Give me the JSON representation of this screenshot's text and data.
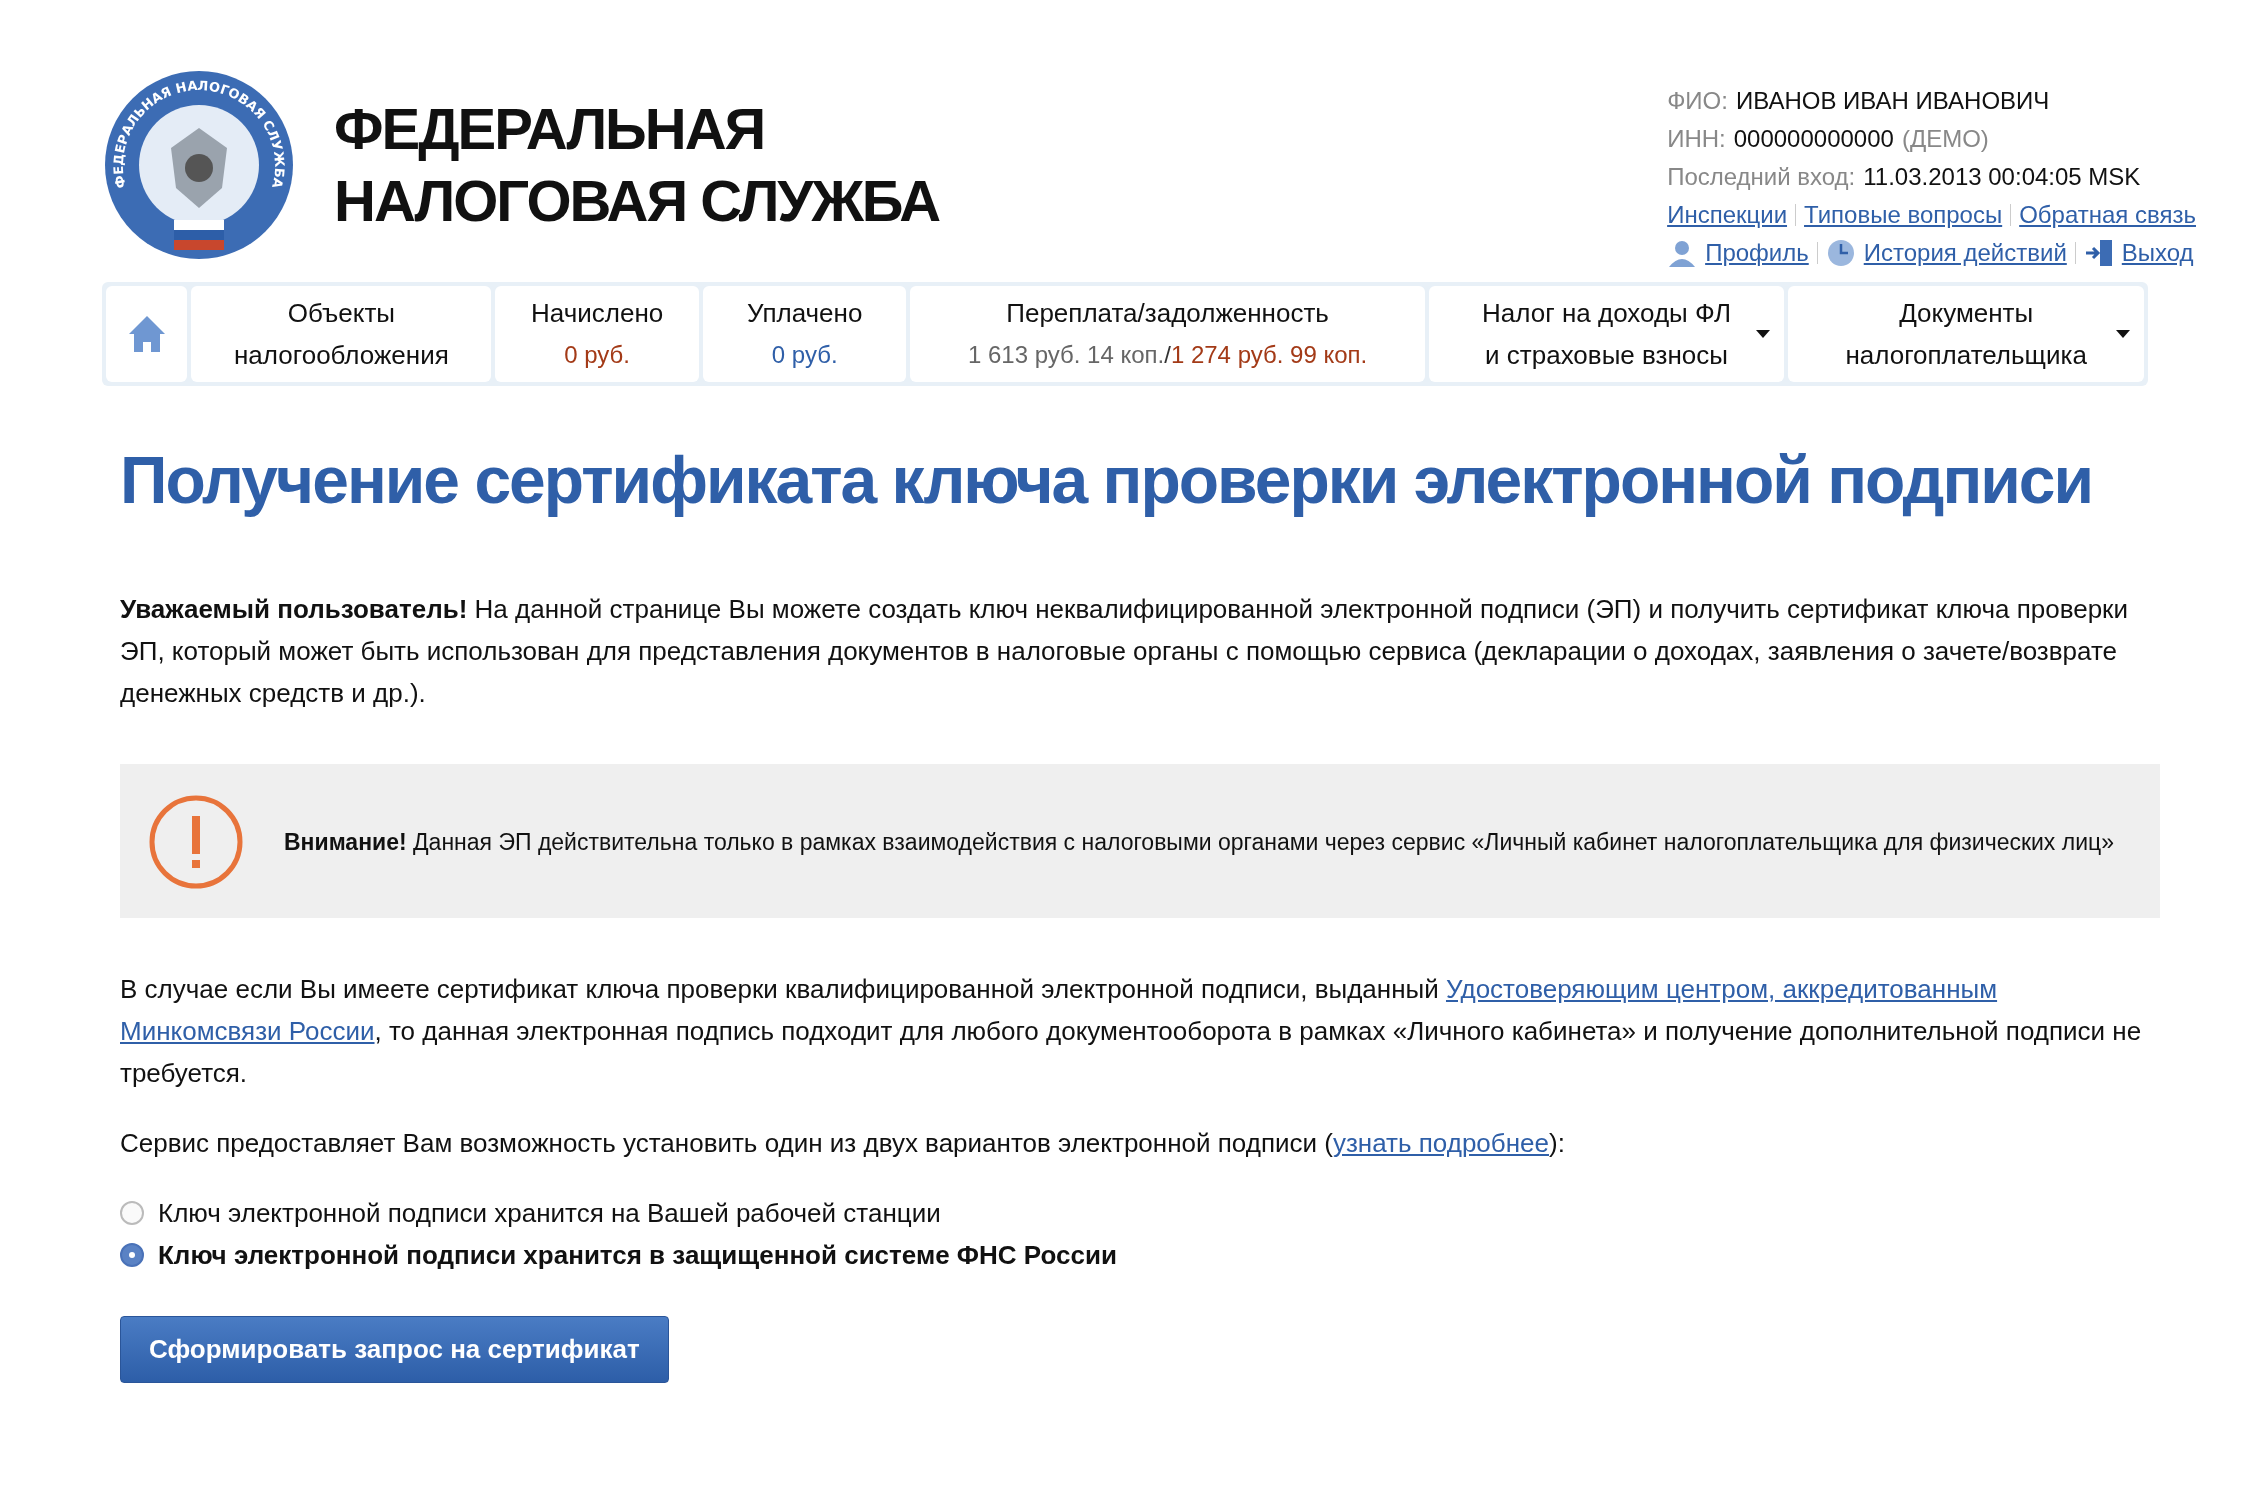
{
  "logo": {
    "ring_text": "ФЕДЕРАЛЬНАЯ НАЛОГОВАЯ СЛУЖБА",
    "title_lines": [
      "ФЕДЕРАЛЬНАЯ",
      "НАЛОГОВАЯ СЛУЖБА"
    ]
  },
  "user": {
    "fields": [
      {
        "label": "ФИО:",
        "value": "ИВАНОВ ИВАН ИВАНОВИЧ"
      },
      {
        "label": "ИНН:",
        "value": "000000000000",
        "note": "(ДЕМО)"
      },
      {
        "label": "Последний вход:",
        "value": "11.03.2013 00:04:05 MSK"
      }
    ],
    "links": [
      "Инспекции",
      "Типовые вопросы",
      "Обратная связь"
    ],
    "actions": [
      {
        "kind": "profile",
        "label": "Профиль"
      },
      {
        "kind": "history",
        "label": "История действий"
      },
      {
        "kind": "exit",
        "label": "Выход"
      }
    ]
  },
  "nav": [
    {
      "kind": "home"
    },
    {
      "kind": "text",
      "lines": [
        "Объекты",
        "налогообложения"
      ]
    },
    {
      "kind": "amount",
      "title": "Начислено",
      "amounts": [
        {
          "text": "0 руб.",
          "color": "#a33a17"
        }
      ]
    },
    {
      "kind": "amount",
      "title": "Уплачено",
      "amounts": [
        {
          "text": "0 руб.",
          "color": "#2f5fa8"
        }
      ]
    },
    {
      "kind": "amount",
      "title": "Переплата/задолженность",
      "amounts": [
        {
          "text": "1 613 руб. 14 коп.",
          "color": "#666666"
        },
        {
          "text": "/",
          "color": "#333333"
        },
        {
          "text": "1 274 руб. 99 коп.",
          "color": "#a33a17"
        }
      ]
    },
    {
      "kind": "dropdown",
      "lines": [
        "Налог на доходы ФЛ",
        "и страховые взносы"
      ]
    },
    {
      "kind": "dropdown",
      "lines": [
        "Документы",
        "налогоплательщика"
      ]
    }
  ],
  "heading": "Получение сертификата ключа проверки электронной подписи",
  "intro": "**Уважаемый пользователь!** На данной странице Вы можете создать ключ неквалифицированной электронной подписи (ЭП) и получить сертификат ключа проверки ЭП, который может быть использован для представления документов в налоговые органы с помощью сервиса (декларации о доходах, заявления о зачете/возврате денежных средств и др.).",
  "warning": "**Внимание!** Данная ЭП действительна только в рамках взаимодействия с налоговыми органами через сервис «Личный кабинет налогоплательщика для физических лиц»",
  "qualified": {
    "before": "В случае если Вы имеете сертификат ключа проверки квалифицированной электронной подписи, выданный ",
    "link_parts": [
      "Удостоверяющим центром, аккредитованным",
      "Минкомсвязи России"
    ],
    "after": ", то данная электронная подпись подходит для любого документооборота в рамках «Личного кабинета» и получение дополнительной подписи не требуется."
  },
  "service": {
    "before": "Сервис предоставляет Вам возможность установить один из двух вариантов электронной подписи (",
    "link": "узнать подробнее",
    "after": "):"
  },
  "options": [
    {
      "label": "Ключ электронной подписи хранится на Вашей рабочей станции",
      "selected": false
    },
    {
      "label": "Ключ электронной подписи хранится в защищенной системе ФНС России",
      "selected": true
    }
  ],
  "submit": "Сформировать запрос на сертификат"
}
